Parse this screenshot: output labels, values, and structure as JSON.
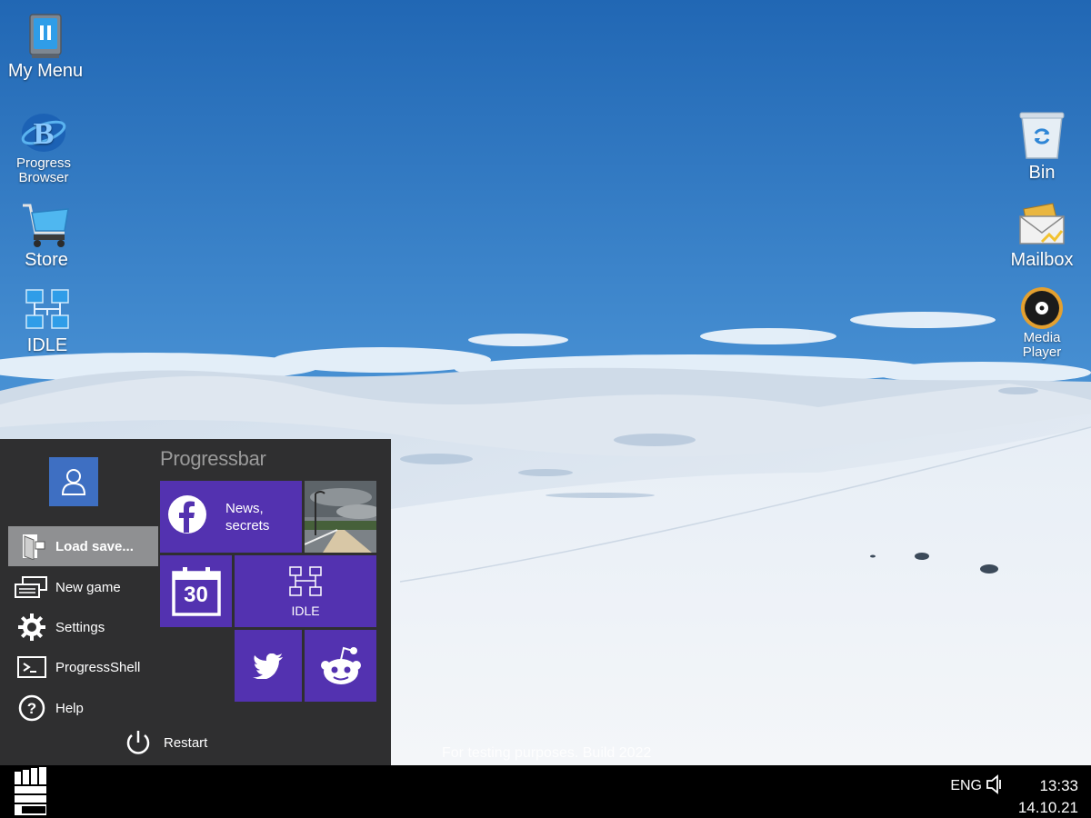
{
  "desktop": {
    "left_icons": [
      {
        "label": "My Menu"
      },
      {
        "label": "Progress Browser"
      },
      {
        "label": "Store"
      },
      {
        "label": "IDLE"
      }
    ],
    "right_icons": [
      {
        "label": "Bin"
      },
      {
        "label": "Mailbox"
      },
      {
        "label": "Media Player"
      }
    ],
    "watermark": "For testing purposes. Build 2022"
  },
  "start_menu": {
    "title": "Progressbar",
    "items": [
      {
        "label": "Load save...",
        "icon": "load-save-icon",
        "active": true
      },
      {
        "label": "New game",
        "icon": "new-game-icon"
      },
      {
        "label": "Settings",
        "icon": "gear-icon"
      },
      {
        "label": "ProgressShell",
        "icon": "terminal-icon"
      },
      {
        "label": "Help",
        "icon": "help-icon"
      }
    ],
    "restart_label": "Restart",
    "tiles": {
      "facebook_line1": "News,",
      "facebook_line2": "secrets",
      "calendar_day": "30",
      "idle_label": "IDLE"
    },
    "colors": {
      "tile": "#5332b0",
      "user_tile": "#3e6fc2",
      "menu_bg": "#2f2f30",
      "active_item": "#8f9092"
    }
  },
  "taskbar": {
    "language": "ENG",
    "time": "13:33",
    "date": "14.10.21"
  }
}
